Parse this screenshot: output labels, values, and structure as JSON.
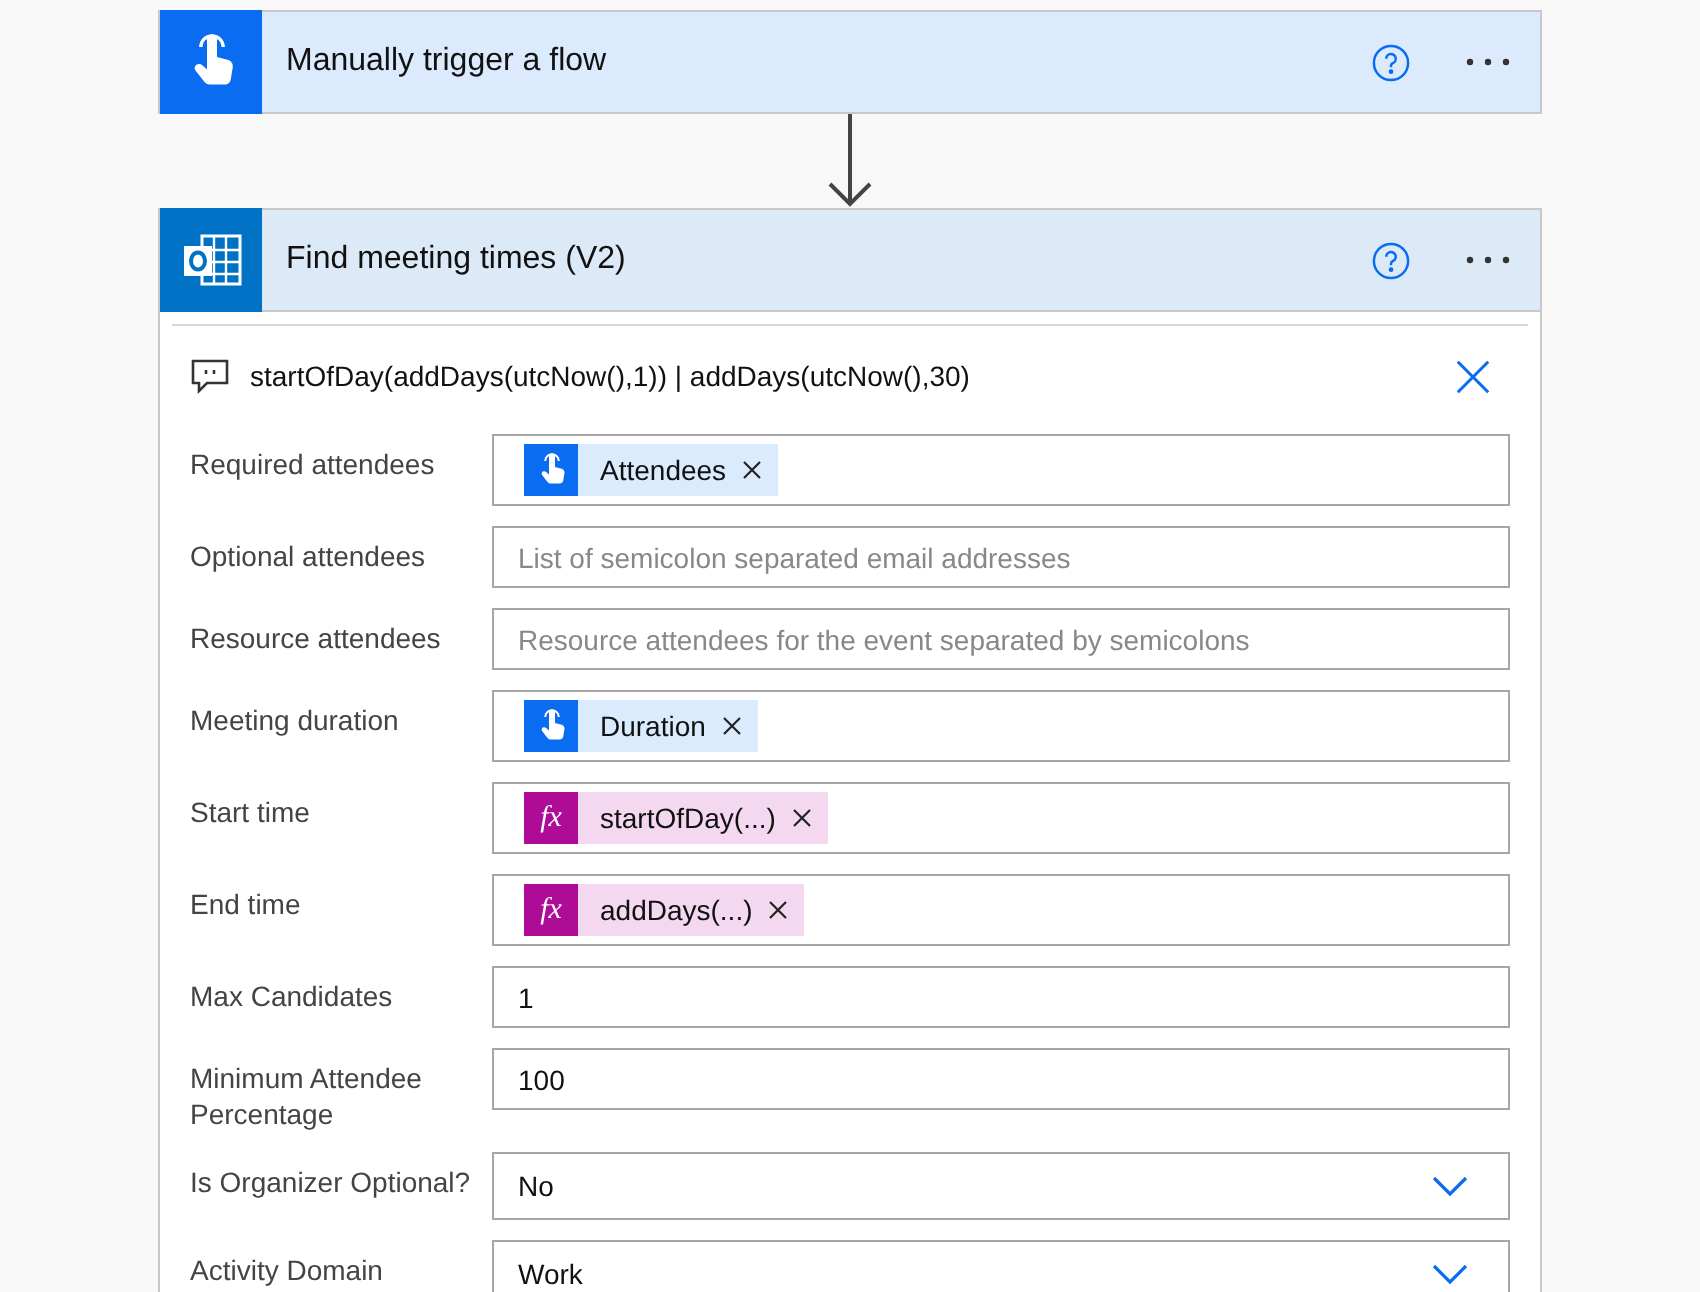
{
  "trigger_card": {
    "title": "Manually trigger a flow"
  },
  "action_card": {
    "title": "Find meeting times (V2)",
    "comment": "startOfDay(addDays(utcNow(),1)) | addDays(utcNow(),30)",
    "fields": [
      {
        "label": "Required attendees",
        "kind": "token",
        "token": {
          "kind": "trigger",
          "text": "Attendees"
        }
      },
      {
        "label": "Optional attendees",
        "kind": "text",
        "placeholder": "List of semicolon separated email addresses"
      },
      {
        "label": "Resource attendees",
        "kind": "text",
        "placeholder": "Resource attendees for the event separated by semicolons"
      },
      {
        "label": "Meeting duration",
        "kind": "token",
        "token": {
          "kind": "trigger",
          "text": "Duration"
        }
      },
      {
        "label": "Start time",
        "kind": "token",
        "token": {
          "kind": "expression",
          "glyph": "fx",
          "text": "startOfDay(...)"
        }
      },
      {
        "label": "End time",
        "kind": "token",
        "token": {
          "kind": "expression",
          "glyph": "fx",
          "text": "addDays(...)"
        }
      },
      {
        "label": "Max Candidates",
        "kind": "text",
        "value": "1"
      },
      {
        "label": "Minimum Attendee Percentage",
        "kind": "text",
        "value": "100"
      },
      {
        "label": "Is Organizer Optional?",
        "kind": "dropdown",
        "value": "No"
      },
      {
        "label": "Activity Domain",
        "kind": "dropdown",
        "value": "Work"
      }
    ]
  }
}
